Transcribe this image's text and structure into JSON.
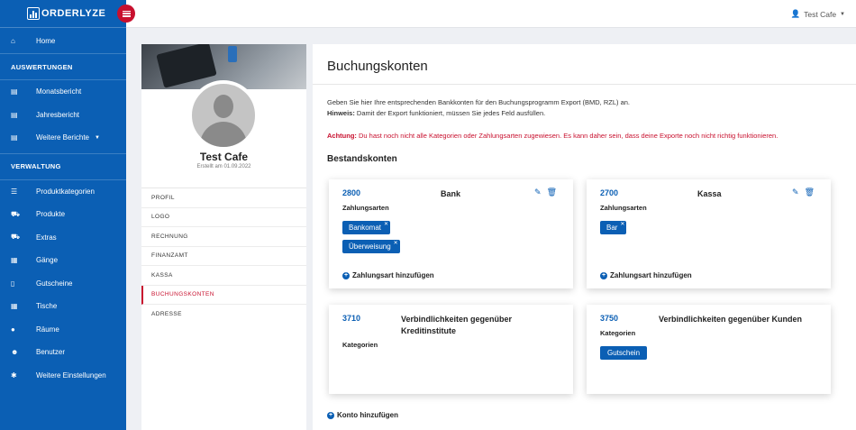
{
  "brand": {
    "name": "ORDERLYZE"
  },
  "topbar": {
    "user": "Test Cafe"
  },
  "sidebar": {
    "home": "Home",
    "section_auswertungen": "AUSWERTUNGEN",
    "auswertungen": [
      "Monatsbericht",
      "Jahresbericht",
      "Weitere Berichte"
    ],
    "section_verwaltung": "VERWALTUNG",
    "verwaltung": [
      "Produktkategorien",
      "Produkte",
      "Extras",
      "Gänge",
      "Gutscheine",
      "Tische",
      "Räume",
      "Benutzer",
      "Weitere Einstellungen"
    ]
  },
  "profile": {
    "name": "Test Cafe",
    "created": "Erstellt am 01.09.2022",
    "nav": [
      "PROFIL",
      "LOGO",
      "RECHNUNG",
      "FINANZAMT",
      "KASSA",
      "BUCHUNGSKONTEN",
      "ADRESSE"
    ],
    "active": "BUCHUNGSKONTEN"
  },
  "main": {
    "title": "Buchungskonten",
    "intro_line1": "Geben Sie hier Ihre entsprechenden Bankkonten für den Buchungsprogramm Export (BMD, RZL) an.",
    "hint_label": "Hinweis:",
    "hint_text": " Damit der Export funktioniert, müssen Sie jedes Feld ausfüllen.",
    "warning_label": "Achtung:",
    "warning_text": " Du hast noch nicht alle Kategorien oder Zahlungsarten zugewiesen. Es kann daher sein, dass deine Exporte noch nicht richtig funktionieren.",
    "section": "Bestandskonten",
    "add_payment": "Zahlungsart hinzufügen",
    "add_account": "Konto hinzufügen",
    "accounts": [
      {
        "number": "2800",
        "name": "Bank",
        "sublabel": "Zahlungsarten",
        "chips": [
          "Bankomat",
          "Überweisung"
        ]
      },
      {
        "number": "2700",
        "name": "Kassa",
        "sublabel": "Zahlungsarten",
        "chips": [
          "Bar"
        ]
      },
      {
        "number": "3710",
        "name": "Verbindlichkeiten gegenüber Kreditinstitute",
        "sublabel": "Kategorien",
        "chips": []
      },
      {
        "number": "3750",
        "name": "Verbindlichkeiten gegenüber Kunden",
        "sublabel": "Kategorien",
        "chips": [
          "Gutschein"
        ]
      }
    ]
  },
  "colors": {
    "brand_blue": "#0b5fb4",
    "accent_red": "#c8102e"
  }
}
